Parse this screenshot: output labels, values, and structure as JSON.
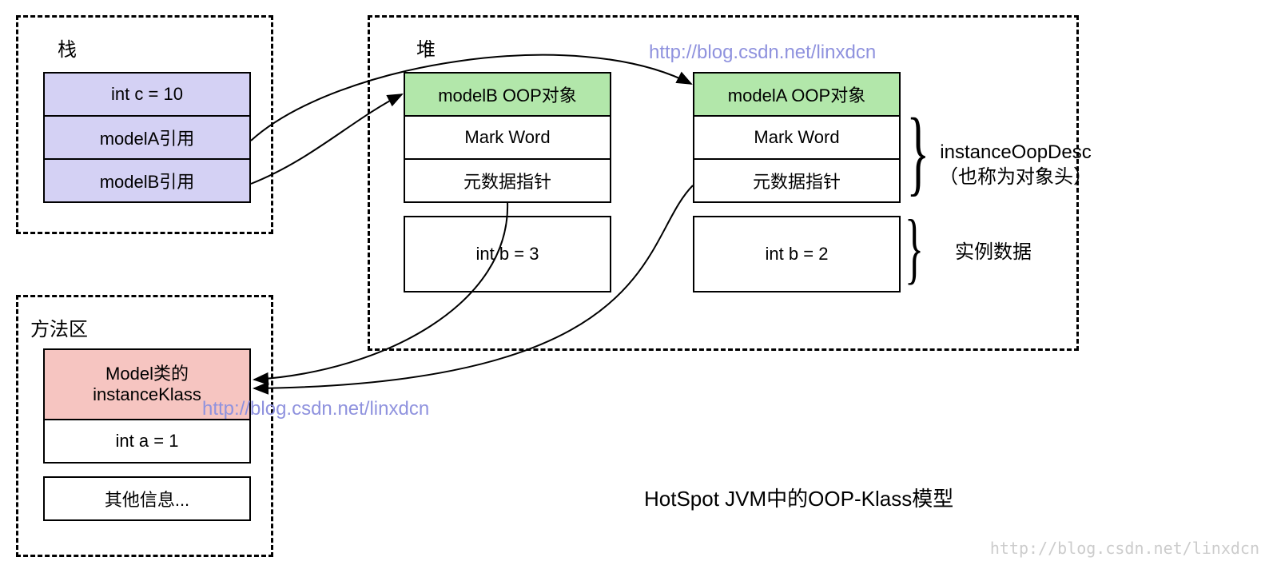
{
  "stack": {
    "label": "栈",
    "cells": [
      "int c = 10",
      "modelA引用",
      "modelB引用"
    ]
  },
  "heap": {
    "label": "堆",
    "modelB": {
      "header": "modelB OOP对象",
      "rows": [
        "Mark Word",
        "元数据指针",
        "int b = 3"
      ]
    },
    "modelA": {
      "header": "modelA OOP对象",
      "rows": [
        "Mark Word",
        "元数据指针",
        "int b = 2"
      ]
    }
  },
  "method_area": {
    "label": "方法区",
    "klass_header": "Model类的\ninstanceKlass",
    "rows": [
      "int a = 1",
      "其他信息..."
    ]
  },
  "annotations": {
    "oopdesc": "instanceOopDesc\n（也称为对象头）",
    "instance_data": "实例数据"
  },
  "caption": "HotSpot JVM中的OOP-Klass模型",
  "watermark": "http://blog.csdn.net/linxdcn",
  "footer_watermark": "http://blog.csdn.net/linxdcn"
}
